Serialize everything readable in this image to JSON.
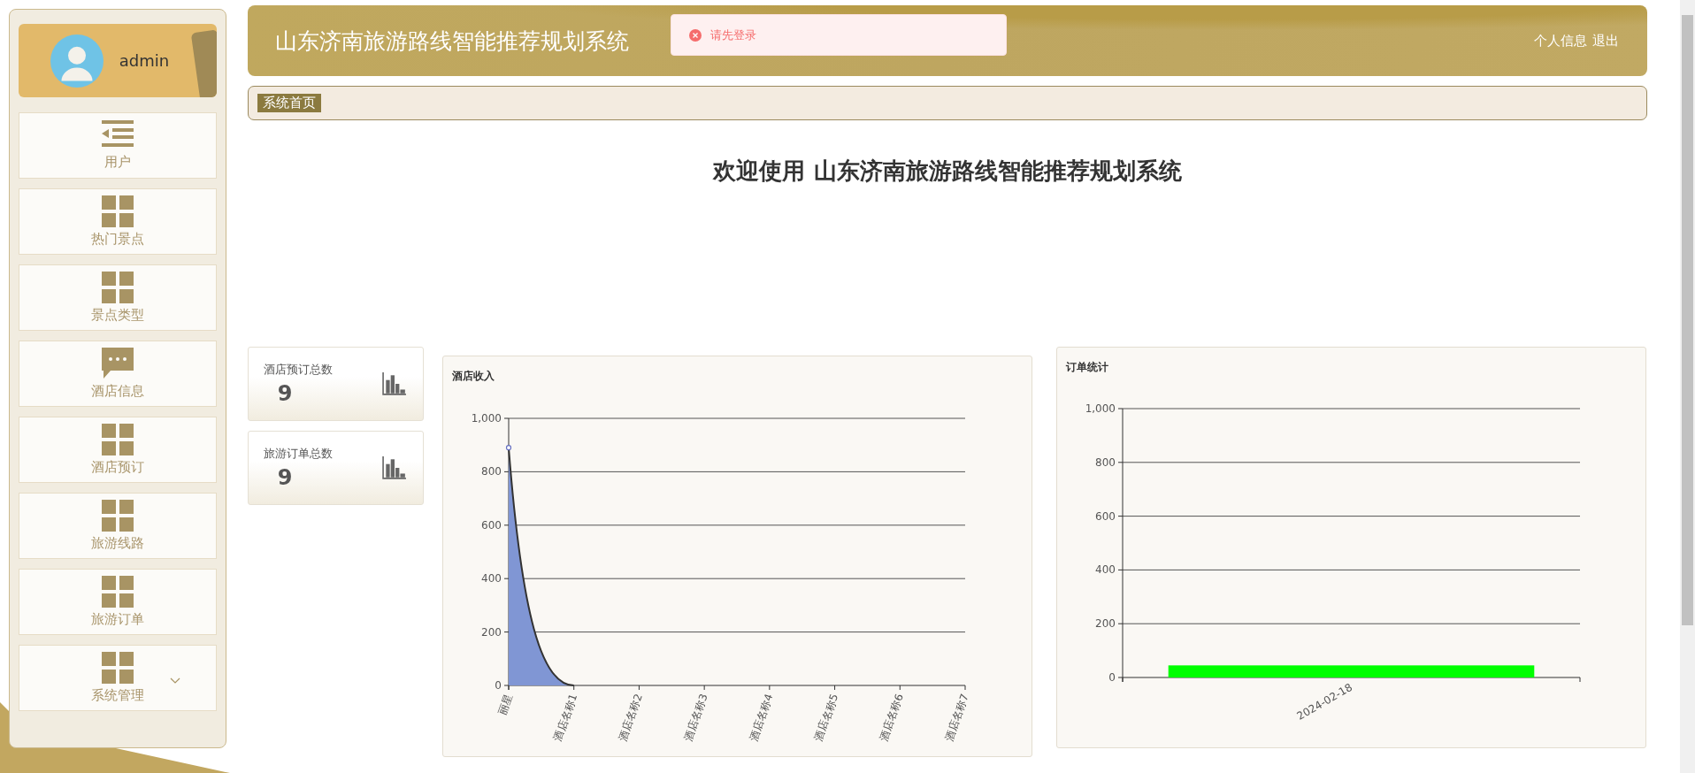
{
  "sidebar": {
    "user": {
      "name": "admin"
    },
    "items": [
      {
        "label": "用户",
        "kind": "list",
        "submenu": false
      },
      {
        "label": "热门景点",
        "kind": "grid",
        "submenu": false
      },
      {
        "label": "景点类型",
        "kind": "grid",
        "submenu": false
      },
      {
        "label": "酒店信息",
        "kind": "message",
        "submenu": false
      },
      {
        "label": "酒店预订",
        "kind": "grid",
        "submenu": false
      },
      {
        "label": "旅游线路",
        "kind": "grid",
        "submenu": false
      },
      {
        "label": "旅游订单",
        "kind": "grid",
        "submenu": false
      },
      {
        "label": "系统管理",
        "kind": "grid",
        "submenu": true
      }
    ]
  },
  "header": {
    "title": "山东济南旅游路线智能推荐规划系统",
    "links": [
      "个人信息",
      "退出"
    ]
  },
  "toast": {
    "kind": "error",
    "message": "请先登录"
  },
  "breadcrumb": [
    "系统首页"
  ],
  "welcome": "欢迎使用 山东济南旅游路线智能推荐规划系统",
  "stats": [
    {
      "label": "酒店预订总数",
      "value": "9"
    },
    {
      "label": "旅游订单总数",
      "value": "9"
    }
  ],
  "charts": [
    {
      "chart_data": {
        "type": "area",
        "title": "酒店收入",
        "categories": [
          "丽星",
          "酒店名称1",
          "酒店名称2",
          "酒店名称3",
          "酒店名称4",
          "酒店名称5",
          "酒店名称6",
          "酒店名称7"
        ],
        "series": [
          {
            "color": "#8096d4",
            "values": [
              890,
              0,
              null,
              null,
              null,
              null,
              null,
              null
            ]
          }
        ],
        "grid": true,
        "ylim": [
          0,
          1000
        ],
        "yticks": [
          0,
          200,
          400,
          600,
          800,
          {
            "value": 1000,
            "label": "1,000"
          }
        ]
      }
    },
    {
      "chart_data": {
        "type": "bar",
        "title": "订单统计",
        "categories": [
          "2024-02-18"
        ],
        "series": [
          {
            "color": "#00ff00",
            "values": [
              45
            ]
          }
        ],
        "grid": true,
        "ylim": [
          0,
          1000
        ],
        "yticks": [
          0,
          200,
          400,
          600,
          800,
          {
            "value": 1000,
            "label": "1,000"
          }
        ]
      }
    }
  ]
}
